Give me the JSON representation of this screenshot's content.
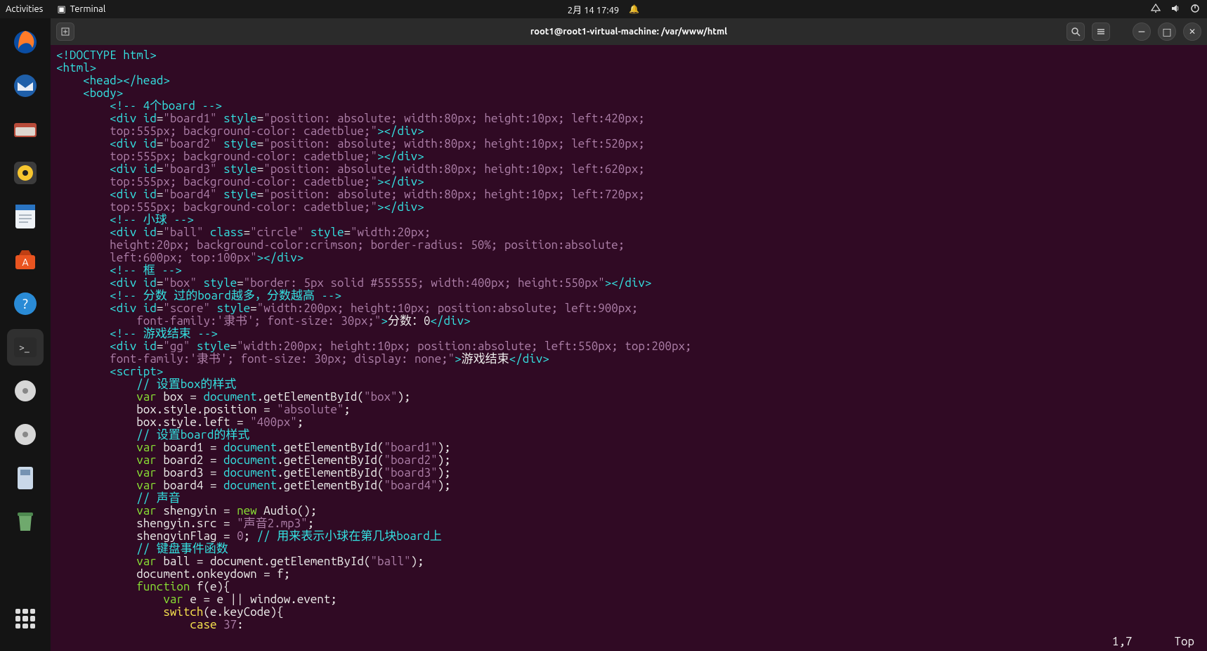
{
  "panel": {
    "activities": "Activities",
    "app_name": "Terminal",
    "clock": "2月 14  17:49"
  },
  "dock": {
    "items": [
      "firefox",
      "thunderbird",
      "files",
      "music",
      "writer",
      "software",
      "help",
      "terminal",
      "disk1",
      "disk2",
      "usb",
      "trash"
    ]
  },
  "window": {
    "title": "root1@root1-virtual-machine: /var/www/html"
  },
  "status": {
    "pos": "1,7",
    "mode": "Top"
  },
  "code": {
    "l01a": "<!DOCTYPE html",
    "l01b": ">",
    "l02a": "<",
    "l02b": "html",
    "l02c": ">",
    "l03a": "<",
    "l03b": "head",
    "l03c": "></",
    "l03d": "head",
    "l03e": ">",
    "l04a": "<",
    "l04b": "body",
    "l04c": ">",
    "c5": "<!-- 4个board -->",
    "d_open": "<",
    "d_div": "div",
    "sp": " ",
    "a_id": "id",
    "eq": "=",
    "v_b1": "\"board1\"",
    "v_b2": "\"board2\"",
    "v_b3": "\"board3\"",
    "v_b4": "\"board4\"",
    "a_style": "style",
    "s_b1": "\"position: absolute; width:80px; height:10px; left:420px;",
    "s_b1b": "top:555px; background-color: cadetblue;\"",
    "s_b2": "\"position: absolute; width:80px; height:10px; left:520px;",
    "s_b3": "\"position: absolute; width:80px; height:10px; left:620px;",
    "s_b4": "\"position: absolute; width:80px; height:10px; left:720px;",
    "close_div": "></",
    "div_end": "div",
    "gt": ">",
    "c_ball": "<!-- 小球 -->",
    "v_ball": "\"ball\"",
    "a_class": "class",
    "v_circle": "\"circle\"",
    "s_ball1": "\"width:20px;",
    "s_ball2": "height:20px; background-color:crimson; border-radius: 50%; position:absolute;",
    "s_ball3": "left:600px; top:100px\"",
    "c_box": "<!-- 框 -->",
    "v_box": "\"box\"",
    "s_box": "\"border: 5px solid #555555; width:400px; height:550px\"",
    "c_score": "<!-- 分数 过的board越多，分数越高 -->",
    "v_score": "\"score\"",
    "s_score1": "\"width:200px; height:10px; position:absolute; left:900px;",
    "s_score2": "    font-family:'隶书'; font-size: 30px;\"",
    "t_score": "分数：0",
    "c_gg": "<!-- 游戏结束 -->",
    "v_gg": "\"gg\"",
    "s_gg1": "\"width:200px; height:10px; position:absolute; left:550px; top:200px;",
    "s_gg2": "font-family:'隶书'; font-size: 30px; display: none;\"",
    "t_gg": "游戏结束",
    "script_open": "<",
    "script_tag": "script",
    "jc1": "// 设置box的样式",
    "kw_var": "var",
    "j_box_a": " box = ",
    "j_doc": "document",
    "j_geb": ".getElementById(",
    "q_box": "\"box\"",
    "paren_sc": ");",
    "j_box_pos": "box.style.position = ",
    "q_abs": "\"absolute\"",
    "sc": ";",
    "j_box_left": "box.style.left = ",
    "q_400": "\"400px\"",
    "jc2": "// 设置board的样式",
    "j_b1": " board1 = ",
    "q_b1": "\"board1\"",
    "j_b2": " board2 = ",
    "q_b2": "\"board2\"",
    "j_b3": " board3 = ",
    "q_b3": "\"board3\"",
    "j_b4": " board4 = ",
    "q_b4": "\"board4\"",
    "jc3": "// 声音",
    "j_sy": " shengyin = ",
    "kw_new": "new",
    "j_audio": " Audio();",
    "j_sysrc": "shengyin.src = ",
    "q_mp3": "\"声音2.mp3\"",
    "j_syflag": "shengyinFlag = ",
    "n0": "0",
    "jc3b": "// 用来表示小球在第几块board上",
    "jc4": "// 键盘事件函数",
    "j_ball": " ball = document.getElementById(",
    "q_ball": "\"ball\"",
    "j_onkey": "document.onkeydown = f;",
    "kw_function": "function",
    "j_fn": " f(e){",
    "j_ev": " e = e || window.event;",
    "kw_switch": "switch",
    "j_switch": "(e.keyCode){",
    "kw_case": "case",
    "n37": "37",
    "colon": ":"
  }
}
